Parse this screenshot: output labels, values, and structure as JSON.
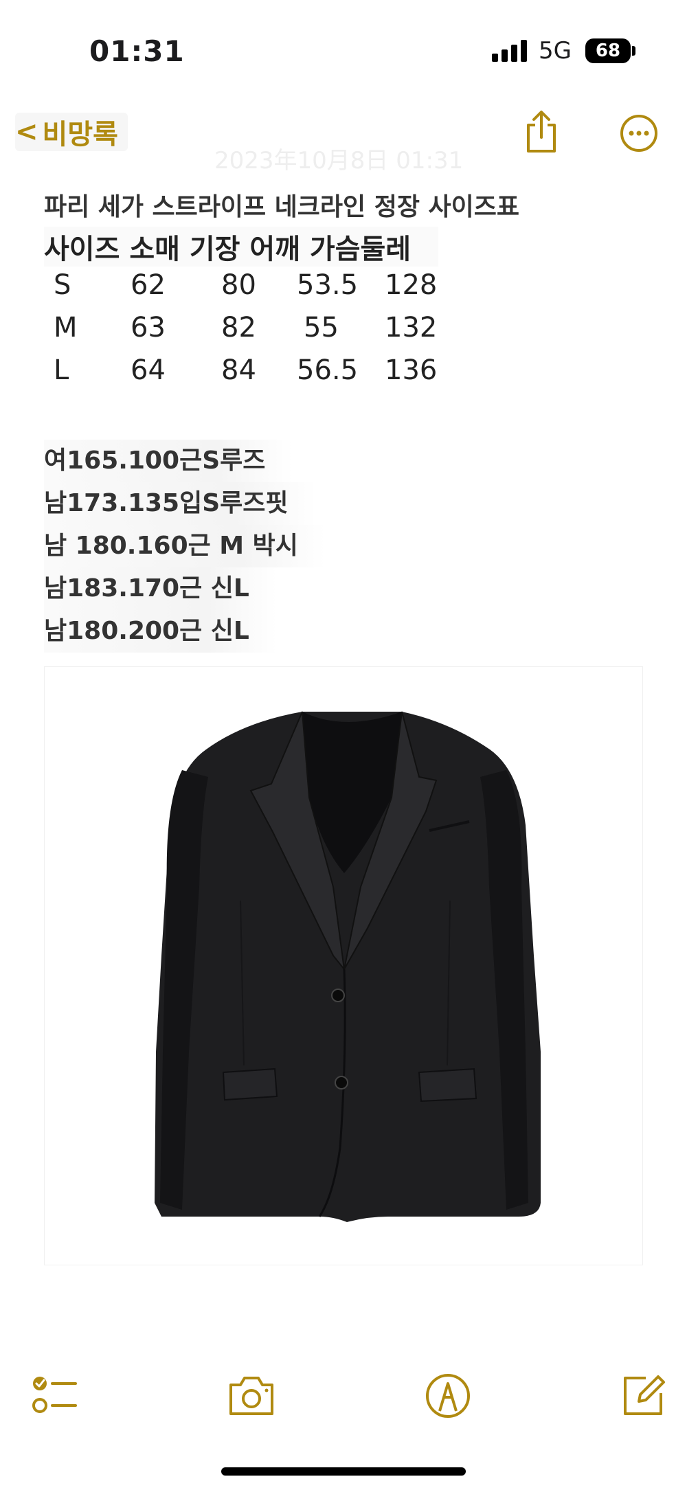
{
  "status_bar": {
    "time": "01:31",
    "network": "5G",
    "battery": "68"
  },
  "nav": {
    "back_label": "비망록",
    "date_line": "2023年10月8日 01:31",
    "share_icon": "share-icon",
    "more_icon": "more-icon"
  },
  "note": {
    "title": "파리 세가 스트라이프 네크라인 정장 사이즈표",
    "header": "사이즈 소매 기장 어깨 가슴둘레",
    "size_rows": [
      {
        "size": "S",
        "sleeve": "62",
        "length": "80",
        "shoulder": "53.5",
        "chest": "128"
      },
      {
        "size": "M",
        "sleeve": "63",
        "length": "82",
        "shoulder": "55",
        "chest": "132"
      },
      {
        "size": "L",
        "sleeve": "64",
        "length": "84",
        "shoulder": "56.5",
        "chest": "136"
      }
    ],
    "fit_notes": [
      "여165.100근S루즈",
      "남173.135입S루즈핏",
      "남 180.160근 M 박시",
      "남183.170근 신L",
      "남180.200근 신L"
    ]
  },
  "colors": {
    "accent": "#b08a10",
    "text": "#222222",
    "jacket": "#1e1e20"
  },
  "toolbar": [
    "checklist-icon",
    "camera-icon",
    "markup-icon",
    "compose-icon"
  ]
}
